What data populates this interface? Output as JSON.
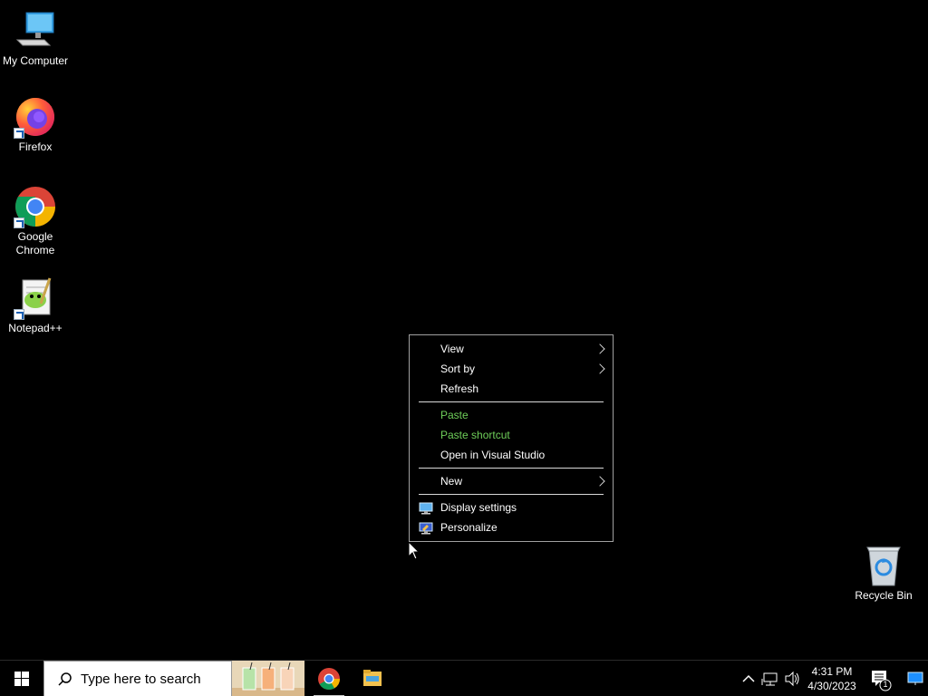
{
  "desktop": {
    "icons": [
      {
        "name": "my-computer",
        "label": "My Computer"
      },
      {
        "name": "firefox",
        "label": "Firefox"
      },
      {
        "name": "google-chrome",
        "label": "Google Chrome"
      },
      {
        "name": "notepad-plus-plus",
        "label": "Notepad++"
      },
      {
        "name": "recycle-bin",
        "label": "Recycle Bin"
      }
    ]
  },
  "context_menu": {
    "view": "View",
    "sort_by": "Sort by",
    "refresh": "Refresh",
    "paste": "Paste",
    "paste_shortcut": "Paste shortcut",
    "open_in_vs": "Open in Visual Studio",
    "new": "New",
    "display_settings": "Display settings",
    "personalize": "Personalize"
  },
  "taskbar": {
    "search_placeholder": "Type here to search",
    "time": "4:31 PM",
    "date": "4/30/2023",
    "notification_count": "1"
  },
  "colors": {
    "disabled_menu_text": "#6fcf5a",
    "desktop_bg": "#000000",
    "menu_border": "#a0a0a0"
  }
}
